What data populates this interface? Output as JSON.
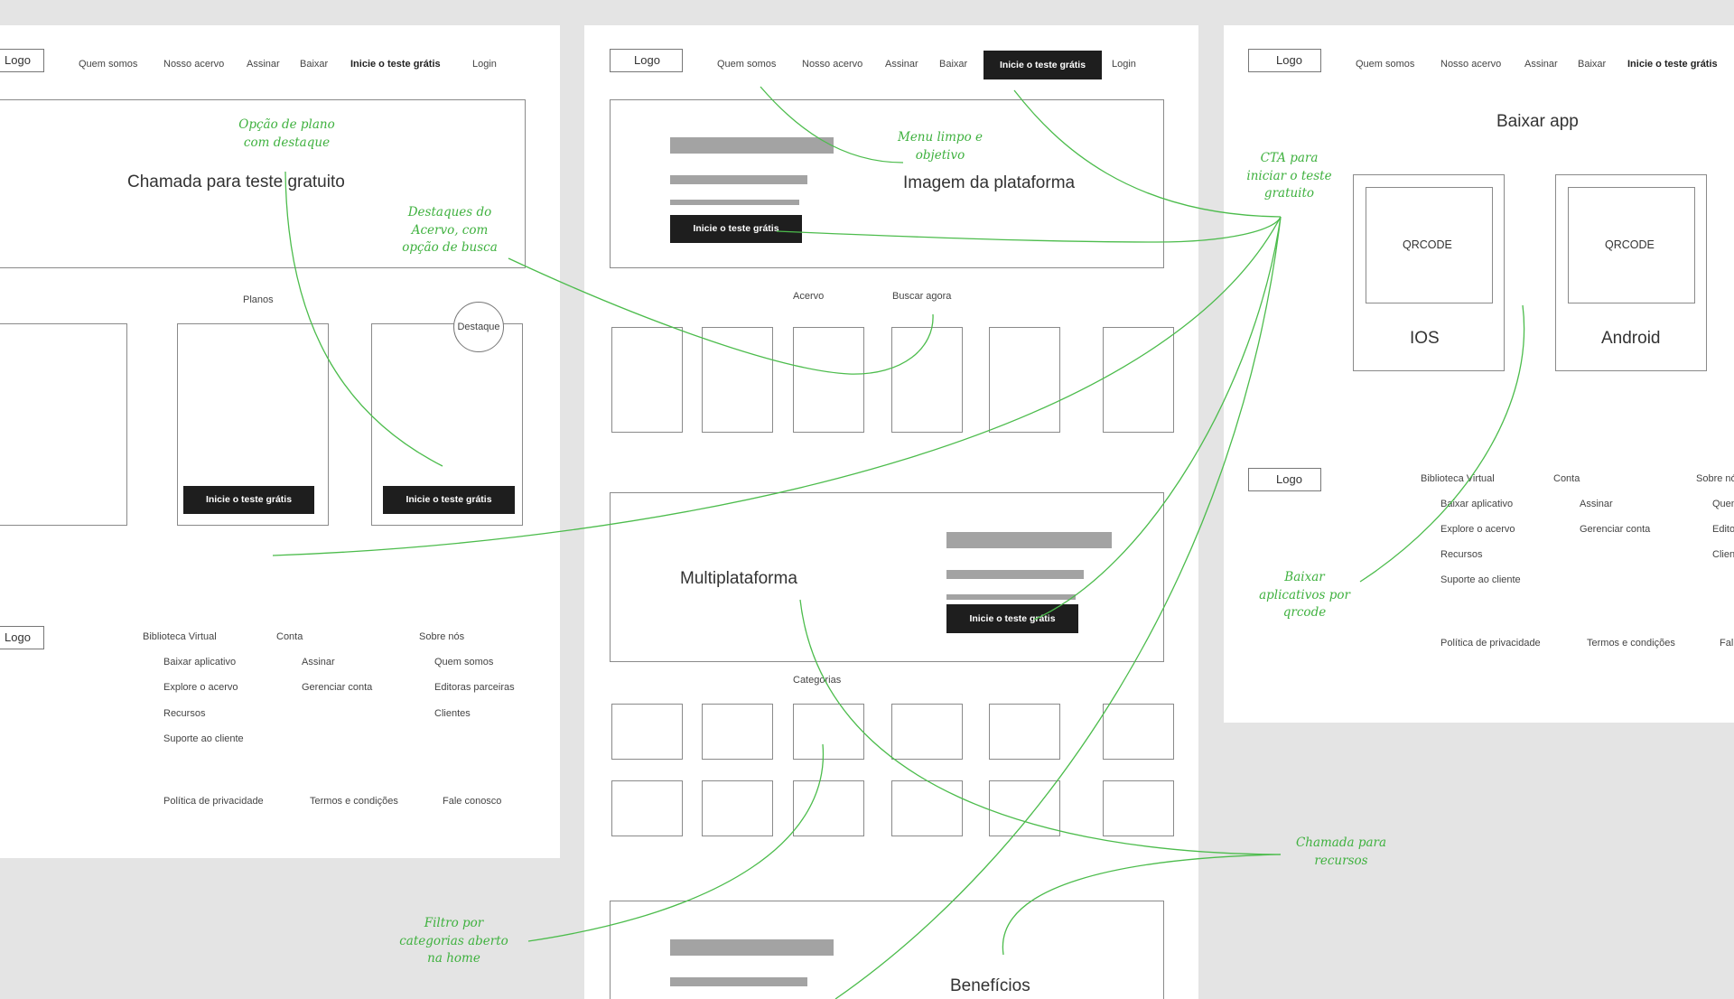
{
  "left_page": {
    "logo": "Logo",
    "nav": [
      "Quem somos",
      "Nosso acervo",
      "Assinar",
      "Baixar",
      "Inicie o teste grátis",
      "Login"
    ],
    "hero_title": "Chamada para teste gratuito",
    "plans_label": "Planos",
    "featured_badge": "Destaque",
    "plan_cta": "Inicie o teste grátis",
    "footer": {
      "logo": "Logo",
      "col1_title": "Biblioteca Virtual",
      "col1_items": [
        "Baixar aplicativo",
        "Explore o acervo",
        "Recursos",
        "Suporte ao cliente"
      ],
      "col2_title": "Conta",
      "col2_items": [
        "Assinar",
        "Gerenciar conta"
      ],
      "col3_title": "Sobre nós",
      "col3_items": [
        "Quem somos",
        "Editoras parceiras",
        "Clientes"
      ],
      "legal": [
        "Política de privacidade",
        "Termos e condições",
        "Fale conosco"
      ]
    }
  },
  "middle_page": {
    "logo": "Logo",
    "nav": [
      "Quem somos",
      "Nosso acervo",
      "Assinar",
      "Baixar",
      "Inicie o teste grátis",
      "Login"
    ],
    "hero_image": "Imagem da plataforma",
    "hero_cta": "Inicie o teste grátis",
    "collection_label": "Acervo",
    "search_label": "Buscar agora",
    "multi_title": "Multiplataforma",
    "multi_cta": "Inicie o teste grátis",
    "categories_label": "Categorias",
    "benefits_title": "Benefícios"
  },
  "right_page": {
    "logo": "Logo",
    "nav": [
      "Quem somos",
      "Nosso acervo",
      "Assinar",
      "Baixar",
      "Inicie o teste grátis"
    ],
    "title": "Baixar app",
    "qr_label": "QRCODE",
    "ios_label": "IOS",
    "android_label": "Android",
    "footer": {
      "logo": "Logo",
      "col1_title": "Biblioteca Virtual",
      "col1_items": [
        "Baixar aplicativo",
        "Explore o acervo",
        "Recursos",
        "Suporte ao cliente"
      ],
      "col2_title": "Conta",
      "col2_items": [
        "Assinar",
        "Gerenciar conta"
      ],
      "col3_title": "Sobre nó",
      "col3_items": [
        "Quen",
        "Edito",
        "Clien"
      ],
      "legal": [
        "Política de privacidade",
        "Termos e condições",
        "Fal"
      ]
    }
  },
  "annotations": {
    "plan_highlight": [
      "Opção de plano",
      "com destaque"
    ],
    "collection_highlights": [
      "Destaques do",
      "Acervo, com",
      "opção de busca"
    ],
    "clean_menu": [
      "Menu limpo e",
      "objetivo"
    ],
    "cta_trial": [
      "CTA para",
      "iniciar o teste",
      "gratuito"
    ],
    "download_qr": [
      "Baixar",
      "aplicativos por",
      "qrcode"
    ],
    "resources_call": [
      "Chamada para",
      "recursos"
    ],
    "category_filter": [
      "Filtro por",
      "categorias aberto",
      "na home"
    ]
  },
  "colors": {
    "background": "#e4e4e4",
    "page": "#ffffff",
    "annotation": "#3fb13f",
    "button": "#1e1e1e",
    "placeholder_bar": "#a3a3a3"
  }
}
